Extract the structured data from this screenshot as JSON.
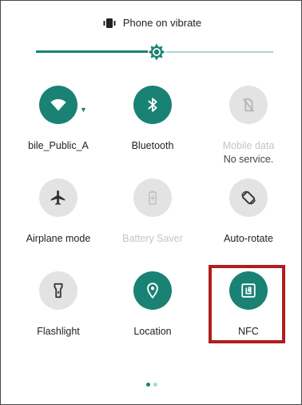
{
  "status": {
    "text": "Phone on vibrate",
    "icon": "vibrate-icon"
  },
  "brightness": {
    "level": 0.51,
    "icon": "brightness-icon"
  },
  "tiles": [
    {
      "id": "wifi",
      "label": "bile_Public_A",
      "icon": "wifi-icon",
      "state": "on"
    },
    {
      "id": "bluetooth",
      "label": "Bluetooth",
      "icon": "bluetooth-icon",
      "state": "on"
    },
    {
      "id": "mobile-data",
      "label": "Mobile data",
      "sublabel": "No service.",
      "icon": "mobile-data-off-icon",
      "state": "disabled"
    },
    {
      "id": "airplane",
      "label": "Airplane mode",
      "icon": "airplane-icon",
      "state": "off"
    },
    {
      "id": "battery-saver",
      "label": "Battery Saver",
      "icon": "battery-icon",
      "state": "disabled"
    },
    {
      "id": "auto-rotate",
      "label": "Auto-rotate",
      "icon": "rotate-icon",
      "state": "off"
    },
    {
      "id": "flashlight",
      "label": "Flashlight",
      "icon": "flashlight-icon",
      "state": "off"
    },
    {
      "id": "location",
      "label": "Location",
      "icon": "location-icon",
      "state": "on"
    },
    {
      "id": "nfc",
      "label": "NFC",
      "icon": "nfc-icon",
      "state": "on"
    }
  ],
  "pager": {
    "pages": 2,
    "current": 1
  },
  "colors": {
    "accent": "#1a8274",
    "accent_light": "#a9d6cd",
    "tile_off": "#e3e3e3",
    "highlight": "#b01e1e"
  }
}
